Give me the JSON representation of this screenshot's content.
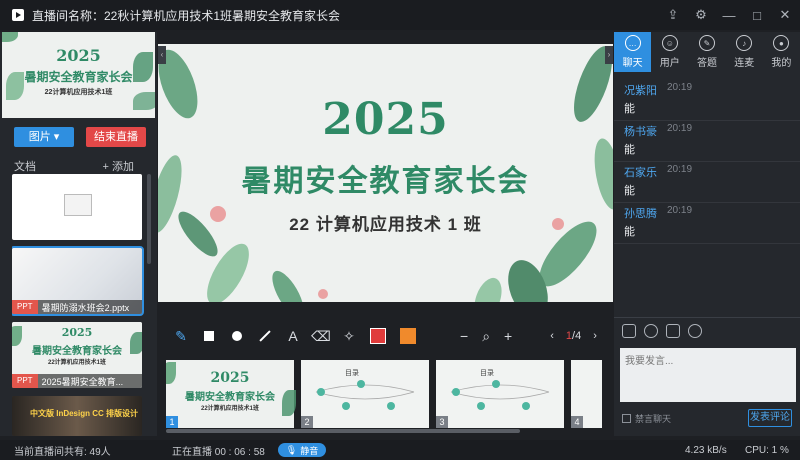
{
  "window": {
    "title": "直播间名称：22秋计算机应用技术1班暑期安全教育家长会",
    "share_icon": "share-icon",
    "settings_icon": "gear-icon",
    "minimize": "—",
    "maximize": "□",
    "close": "✕"
  },
  "slide": {
    "year": "2025",
    "title": "暑期安全教育家长会",
    "subtitle": "22 计算机应用技术 1 班"
  },
  "mini_slide": {
    "year": "2025",
    "title": "暑期安全教育家长会",
    "subtitle": "22计算机应用技术1班"
  },
  "left": {
    "image_button": "图片 ▾",
    "end_button": "结束直播",
    "docs_label": "文档",
    "add_label": "+ 添加",
    "documents": [
      {
        "type": "",
        "name": ""
      },
      {
        "type": "PPT",
        "name": "暑期防溺水班会2.pptx"
      },
      {
        "type": "PPT",
        "name": "2025暑期安全教育..."
      },
      {
        "type": "",
        "name": "中文版 InDesign CC 排版设计"
      }
    ]
  },
  "toolbar": {
    "minus": "−",
    "plus": "+",
    "page_prev": "‹",
    "page_current": "1",
    "page_total": "/4",
    "page_next": "›",
    "text_tool": "A"
  },
  "thumbnails": [
    {
      "num": "1",
      "year": "2025",
      "title": "暑期安全教育家长会",
      "sub": "22计算机应用技术1班"
    },
    {
      "num": "2",
      "heading": "目录"
    },
    {
      "num": "3",
      "heading": "目录"
    },
    {
      "num": "4",
      "heading": ""
    }
  ],
  "right": {
    "tabs": [
      {
        "label": "聊天",
        "icon": "chat-icon"
      },
      {
        "label": "用户",
        "icon": "users-icon"
      },
      {
        "label": "答题",
        "icon": "pen-icon"
      },
      {
        "label": "连麦",
        "icon": "mic-icon"
      },
      {
        "label": "我的",
        "icon": "profile-icon"
      }
    ],
    "messages": [
      {
        "user": "况紫阳",
        "time": "20:19",
        "text": "能"
      },
      {
        "user": "杨书豪",
        "time": "20:19",
        "text": "能"
      },
      {
        "user": "石家乐",
        "time": "20:19",
        "text": "能"
      },
      {
        "user": "孙思腾",
        "time": "20:19",
        "text": "能"
      }
    ],
    "input_placeholder": "我要发言...",
    "mute_label": "禁言聊天",
    "send_button": "发表评论"
  },
  "status": {
    "viewers": "当前直播间共有: 49人",
    "live_time": "正在直播 00 : 06 : 58",
    "mute_label": "静音",
    "speed": "4.23 kB/s",
    "cpu": "CPU:  1 %"
  },
  "colors": {
    "accent": "#2f8fe0",
    "danger": "#e34848",
    "slide_green": "#2f8a66"
  }
}
